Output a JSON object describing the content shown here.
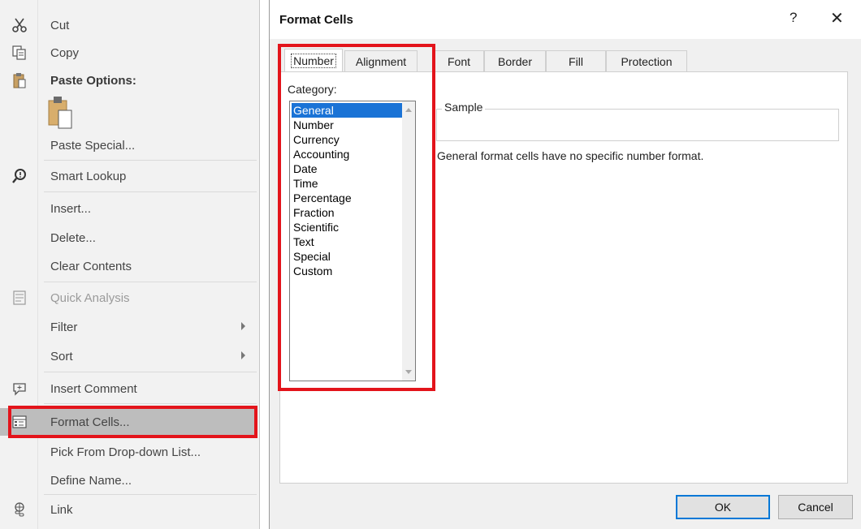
{
  "context_menu": {
    "items": [
      {
        "label": "Cut",
        "icon": "scissors-icon"
      },
      {
        "label": "Copy",
        "icon": "copy-icon"
      },
      {
        "label": "Paste Options:",
        "icon": "paste-icon"
      },
      {
        "label": "Paste Special...",
        "icon": ""
      },
      {
        "label": "Smart Lookup",
        "icon": "smart-lookup-icon"
      },
      {
        "label": "Insert...",
        "icon": ""
      },
      {
        "label": "Delete...",
        "icon": ""
      },
      {
        "label": "Clear Contents",
        "icon": ""
      },
      {
        "label": "Quick Analysis",
        "icon": "quick-analysis-icon"
      },
      {
        "label": "Filter",
        "icon": ""
      },
      {
        "label": "Sort",
        "icon": ""
      },
      {
        "label": "Insert Comment",
        "icon": "comment-icon"
      },
      {
        "label": "Format Cells...",
        "icon": "format-cells-icon"
      },
      {
        "label": "Pick From Drop-down List...",
        "icon": ""
      },
      {
        "label": "Define Name...",
        "icon": ""
      },
      {
        "label": "Link",
        "icon": "link-icon"
      }
    ]
  },
  "dialog": {
    "title": "Format Cells",
    "help_label": "?",
    "close_label": "✕",
    "tabs": [
      {
        "label": "Number"
      },
      {
        "label": "Alignment"
      },
      {
        "label": "Font"
      },
      {
        "label": "Border"
      },
      {
        "label": "Fill"
      },
      {
        "label": "Protection"
      }
    ],
    "category_label": "Category:",
    "categories": [
      "General",
      "Number",
      "Currency",
      "Accounting",
      "Date",
      "Time",
      "Percentage",
      "Fraction",
      "Scientific",
      "Text",
      "Special",
      "Custom"
    ],
    "selected_category": "General",
    "sample_label": "Sample",
    "description": "General format cells have no specific number format.",
    "ok_label": "OK",
    "cancel_label": "Cancel"
  },
  "colors": {
    "highlight_red": "#e3141b",
    "selection_blue": "#1a73d6"
  }
}
